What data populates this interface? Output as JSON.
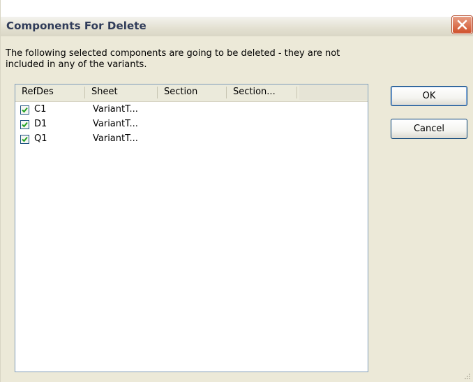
{
  "window": {
    "title": "Components For Delete",
    "message": "The following selected components are going to be deleted - they are not included in any of the variants."
  },
  "table": {
    "columns": [
      "RefDes",
      "Sheet",
      "Section",
      "Section..."
    ],
    "rows": [
      {
        "refdes": "C1",
        "sheet": "VariantT...",
        "checked": true
      },
      {
        "refdes": "D1",
        "sheet": "VariantT...",
        "checked": true
      },
      {
        "refdes": "Q1",
        "sheet": "VariantT...",
        "checked": true
      }
    ]
  },
  "buttons": {
    "ok_label": "OK",
    "cancel_label": "Cancel"
  },
  "colors": {
    "close_button": "#d0522c",
    "check_mark": "#21a121",
    "list_border": "#7f9db9"
  },
  "icons": {
    "close": "close-icon",
    "check": "check-icon",
    "resize": "resize-grip-icon"
  }
}
